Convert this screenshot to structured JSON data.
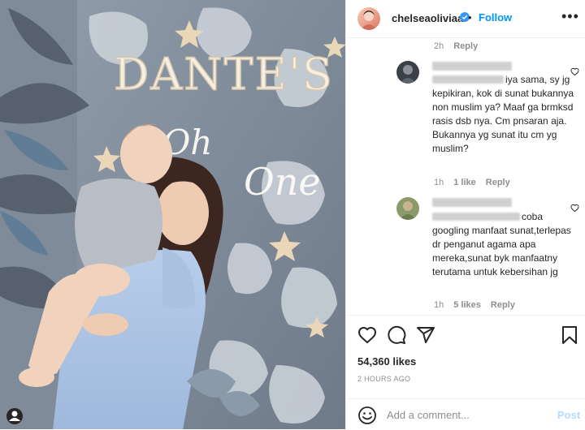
{
  "photo": {
    "sign_text": "DANTE'S"
  },
  "header": {
    "username": "chelseaoliviaa",
    "follow_label": "Follow",
    "separator": "•"
  },
  "prev_comment_meta": {
    "time": "2h",
    "reply_label": "Reply"
  },
  "comments": [
    {
      "text": "iya sama, sy jg kepikiran, kok di sunat bukannya non muslim ya? Maaf ga brmksd rasis dsb nya. Cm pnsaran aja. Bukannya yg sunat itu cm yg muslim?",
      "time": "1h",
      "likes": "1 like",
      "reply_label": "Reply"
    },
    {
      "text": "coba googling manfaat sunat,terlepas dr penganut agama apa mereka,sunat byk manfaatny terutama untuk kebersihan jg",
      "time": "1h",
      "likes": "5 likes",
      "reply_label": "Reply"
    }
  ],
  "post": {
    "likes_count": "54,360 likes",
    "time_ago": "2 HOURS AGO"
  },
  "comment_box": {
    "placeholder": "Add a comment...",
    "post_label": "Post"
  },
  "colors": {
    "accent": "#0095f6",
    "text": "#262626",
    "muted": "#8e8e8e",
    "divider": "#efefef"
  },
  "icons": [
    "verified-icon",
    "more-icon",
    "heart-icon",
    "comment-icon",
    "share-icon",
    "save-icon",
    "emoji-icon"
  ]
}
